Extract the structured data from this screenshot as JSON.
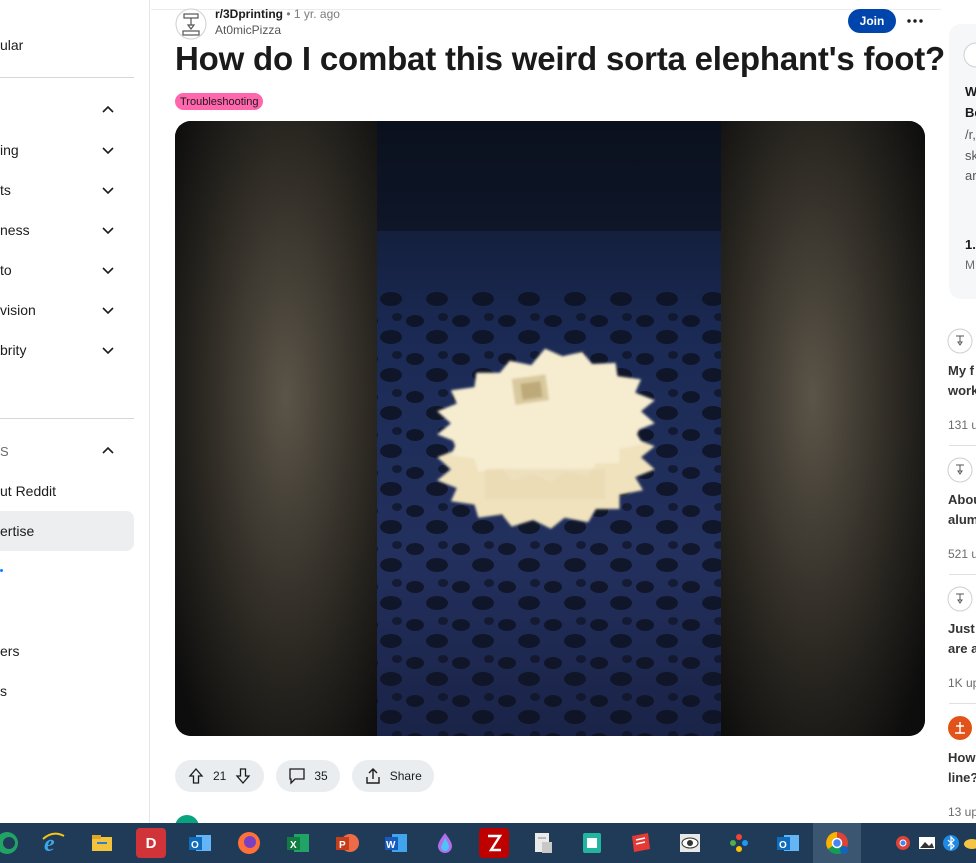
{
  "sidebar": {
    "top_item": "ular",
    "groups": [
      {
        "label": "ing"
      },
      {
        "label": "ts"
      },
      {
        "label": "ness"
      },
      {
        "label": "to"
      },
      {
        "label": "vision"
      },
      {
        "label": "brity"
      }
    ],
    "resources_header": "S",
    "resources": [
      {
        "label": "ut Reddit"
      },
      {
        "label": "ertise"
      },
      {
        "label": ""
      },
      {
        "label": ""
      },
      {
        "label": "ers"
      },
      {
        "label": "s"
      }
    ]
  },
  "post": {
    "subreddit": "r/3Dprinting",
    "age": "• 1 yr. ago",
    "author": "At0micPizza",
    "join_label": "Join",
    "title": "How do I combat this weird sorta elephant's foot?",
    "flair": "Troubleshooting",
    "votes": "21",
    "comments": "35",
    "share_label": "Share"
  },
  "right_column": {
    "card_lines": [
      "W",
      "Be",
      "/r,",
      "sk",
      "ar"
    ],
    "card_footer_bold": "1.",
    "card_footer": "M",
    "related": [
      {
        "title_line1": "My f",
        "title_line2": "work",
        "meta": "131 u"
      },
      {
        "title_line1": "Abou",
        "title_line2": "alum",
        "meta": "521 u"
      },
      {
        "title_line1": "Just",
        "title_line2": "are a",
        "meta": "1K up"
      },
      {
        "title_line1": "How",
        "title_line2": "line?",
        "meta": "13 up"
      }
    ]
  },
  "colors": {
    "join": "#0045ac",
    "flair": "#ff66ac",
    "taskbar": "#1f3b57",
    "gear": "#f1e6c4"
  },
  "taskbar": {
    "apps": [
      "edge-icon",
      "internet-explorer-icon",
      "file-explorer-icon",
      "d-app-icon",
      "outlook-icon",
      "firefox-icon",
      "excel-icon",
      "powerpoint-icon",
      "word-icon",
      "paint-drop-icon",
      "filezilla-icon",
      "notepad-icon",
      "zip-icon",
      "sketchup-icon",
      "eye-app-icon",
      "dots-app-icon",
      "outlook-icon-2",
      "chrome-icon"
    ]
  }
}
